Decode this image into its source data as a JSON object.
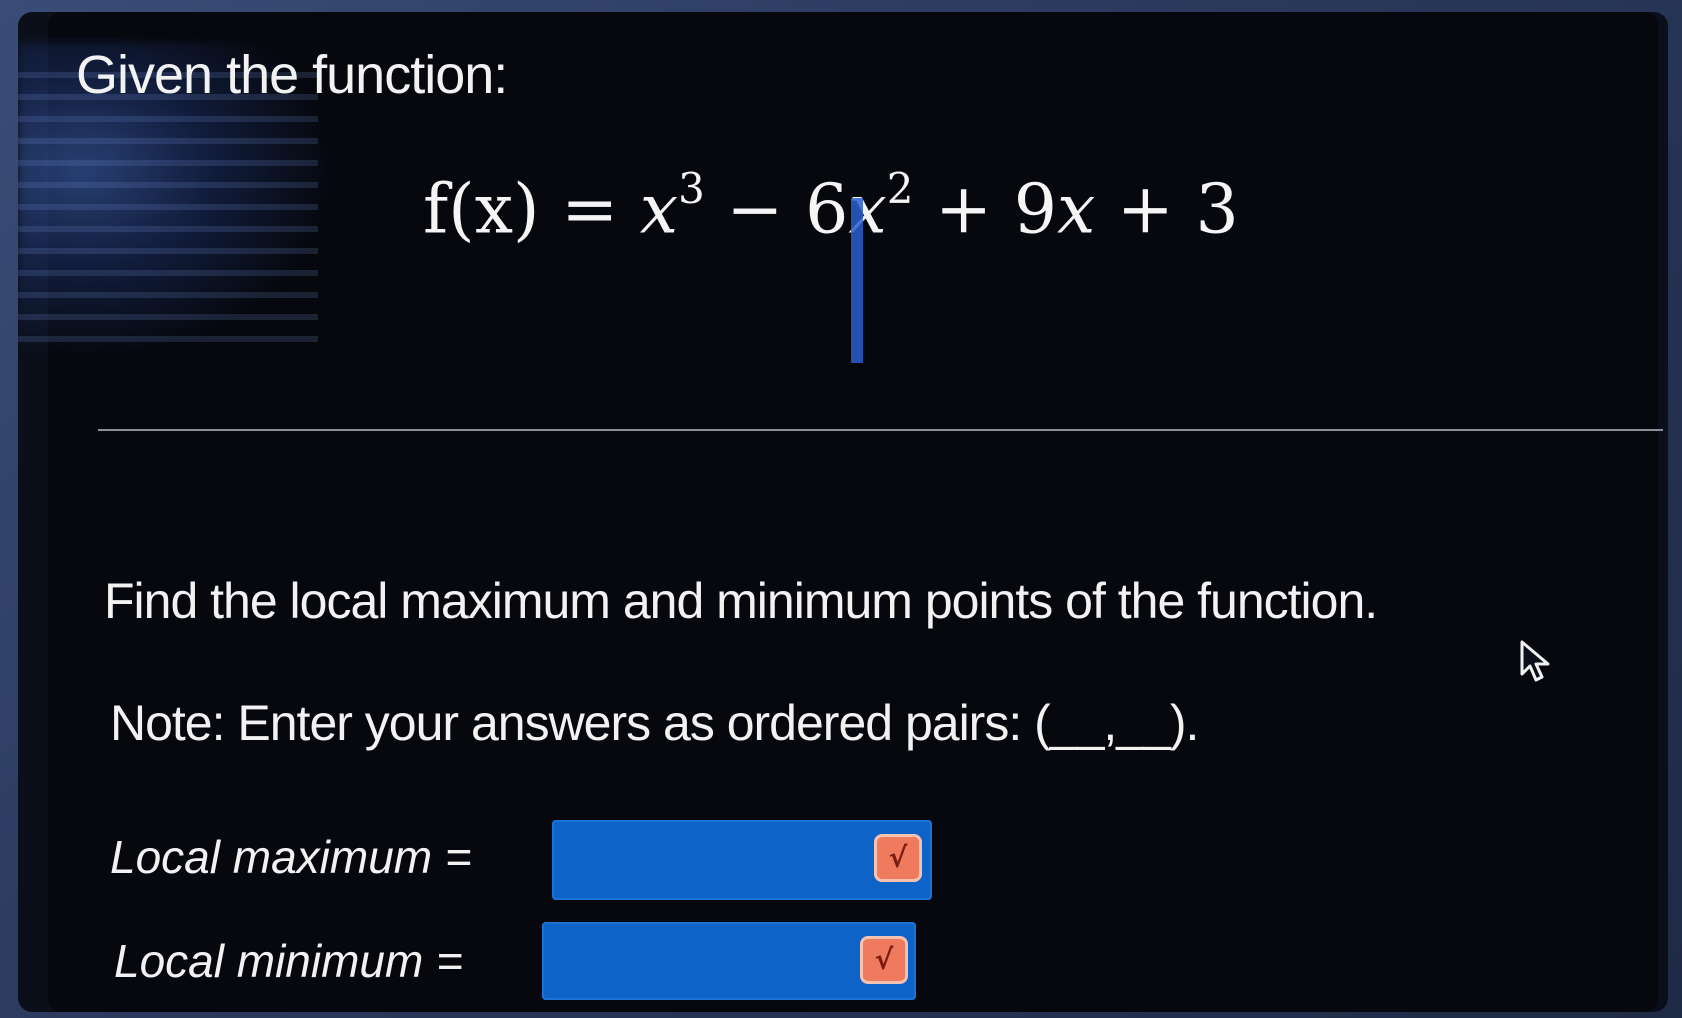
{
  "question": {
    "title": "Given the function:",
    "formula": {
      "lhs": "f(x) = ",
      "t1_var": "x",
      "t1_exp": "3",
      "op1": " − ",
      "t2_coef": "6",
      "t2_var": "x",
      "t2_exp": "2",
      "op2": " + ",
      "t3_coef": "9",
      "t3_var": "x",
      "op3": " + ",
      "t4": "3"
    },
    "prompt": "Find the local maximum and minimum points of the function.",
    "note": "Note: Enter your answers as ordered pairs: (__,__)."
  },
  "answers": {
    "max_label": "Local maximum =",
    "max_value": "",
    "min_label": "Local minimum =",
    "min_value": ""
  },
  "icons": {
    "sqrt_button": "sqrt-icon",
    "mouse_pointer": "cursor-arrow-icon"
  },
  "colors": {
    "background": "#06080e",
    "answer_box": "#0d63c7",
    "sqrt_button": "#f07a5e"
  }
}
